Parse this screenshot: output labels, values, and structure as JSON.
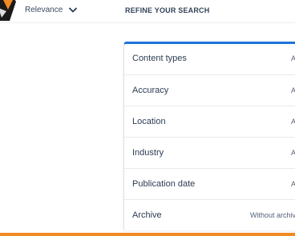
{
  "sort": {
    "label": "Relevance"
  },
  "refine": {
    "title": "REFINE YOUR SEARCH"
  },
  "filters": [
    {
      "label": "Content types",
      "value": "A"
    },
    {
      "label": "Accuracy",
      "value": "A"
    },
    {
      "label": "Location",
      "value": "A"
    },
    {
      "label": "Industry",
      "value": "A"
    },
    {
      "label": "Publication date",
      "value": "A"
    },
    {
      "label": "Archive",
      "value": "Without archiv"
    }
  ],
  "icons": {
    "sort_chevron": "chevron-down-icon",
    "logo": "logo-icon"
  },
  "colors": {
    "accent_blue": "#1f73d8",
    "accent_orange": "#f08a24",
    "text_dark": "#2c3c52"
  }
}
